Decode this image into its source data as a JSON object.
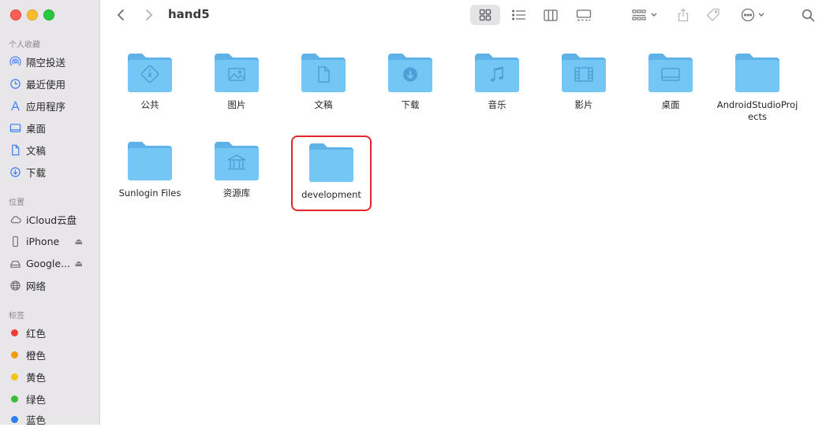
{
  "window": {
    "title": "hand5"
  },
  "sidebar": {
    "favorites_title": "个人收藏",
    "favorites": [
      {
        "label": "隔空投送",
        "icon": "airdrop-icon"
      },
      {
        "label": "最近使用",
        "icon": "clock-icon"
      },
      {
        "label": "应用程序",
        "icon": "applications-icon"
      },
      {
        "label": "桌面",
        "icon": "desktop-icon"
      },
      {
        "label": "文稿",
        "icon": "document-icon"
      },
      {
        "label": "下载",
        "icon": "download-icon"
      }
    ],
    "locations_title": "位置",
    "locations": [
      {
        "label": "iCloud云盘",
        "icon": "cloud-icon",
        "eject": false
      },
      {
        "label": "iPhone",
        "icon": "phone-icon",
        "eject": true
      },
      {
        "label": "Google...",
        "icon": "drive-icon",
        "eject": true
      },
      {
        "label": "网络",
        "icon": "globe-icon",
        "eject": false
      }
    ],
    "eject_glyph": "⏏",
    "tags_title": "标签",
    "tags": [
      {
        "label": "红色",
        "color": "#f23c35"
      },
      {
        "label": "橙色",
        "color": "#f19a0f"
      },
      {
        "label": "黄色",
        "color": "#f2c511"
      },
      {
        "label": "绿色",
        "color": "#3dbc3a"
      },
      {
        "label": "蓝色",
        "color": "#2f7ef0"
      }
    ]
  },
  "folders": [
    {
      "label": "公共",
      "glyph": "public"
    },
    {
      "label": "图片",
      "glyph": "pictures"
    },
    {
      "label": "文稿",
      "glyph": "documents"
    },
    {
      "label": "下载",
      "glyph": "downloads"
    },
    {
      "label": "音乐",
      "glyph": "music"
    },
    {
      "label": "影片",
      "glyph": "movies"
    },
    {
      "label": "桌面",
      "glyph": "desktop"
    },
    {
      "label": "AndroidStudioProjects",
      "glyph": "none"
    },
    {
      "label": "Sunlogin Files",
      "glyph": "none"
    },
    {
      "label": "资源库",
      "glyph": "library"
    },
    {
      "label": "development",
      "glyph": "none",
      "highlighted": true
    }
  ],
  "colors": {
    "folder_back": "#5fb2e8",
    "folder_front": "#74c7f5",
    "glyph": "#4e9fd6",
    "highlight": "#e0262b"
  }
}
